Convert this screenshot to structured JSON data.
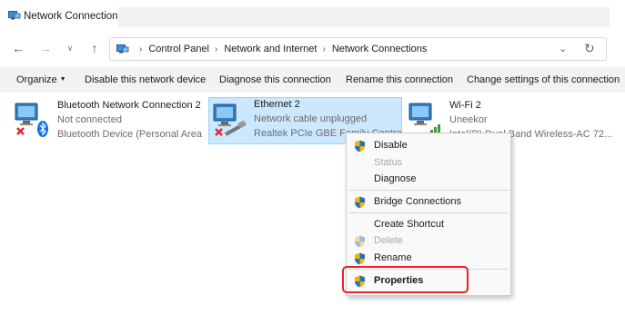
{
  "window": {
    "title": "Network Connections",
    "icon": "network-connections-icon"
  },
  "address": {
    "crumbs": [
      "Control Panel",
      "Network and Internet",
      "Network Connections"
    ],
    "icons": [
      "back-arrow-icon",
      "forward-arrow-icon",
      "chevron-down-icon",
      "up-arrow-icon",
      "refresh-icon"
    ]
  },
  "commands": {
    "organize": "Organize",
    "disable": "Disable this network device",
    "diagnose": "Diagnose this connection",
    "rename": "Rename this connection",
    "change": "Change settings of this connection"
  },
  "adapters": [
    {
      "name": "Bluetooth Network Connection 2",
      "status": "Not connected",
      "device": "Bluetooth Device (Personal Area ...",
      "icon": "bluetooth-adapter-icon"
    },
    {
      "name": "Ethernet 2",
      "status": "Network cable unplugged",
      "device": "Realtek PCIe GBE Family Controller",
      "icon": "ethernet-adapter-icon",
      "selected": true
    },
    {
      "name": "Wi-Fi 2",
      "status": "Uneekor",
      "device": "Intel(R) Dual Band Wireless-AC 72...",
      "icon": "wifi-adapter-icon"
    }
  ],
  "menu": {
    "disable": "Disable",
    "status": "Status",
    "diagnose": "Diagnose",
    "bridge": "Bridge Connections",
    "shortcut": "Create Shortcut",
    "delete": "Delete",
    "rename": "Rename",
    "properties": "Properties"
  },
  "colors": {
    "selection": "#cce8ff",
    "highlight_box": "#e3242b",
    "error_x": "#d9282f",
    "bluetooth": "#1473e6"
  }
}
